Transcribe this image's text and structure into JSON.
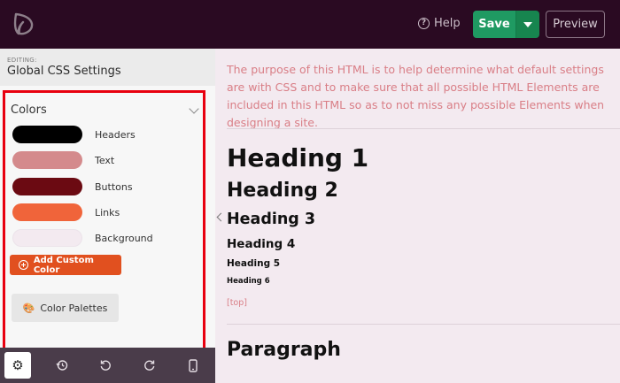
{
  "topbar": {
    "logo_icon": "leaf-logo-icon",
    "help_label": "Help",
    "save_label": "Save",
    "preview_label": "Preview"
  },
  "sidebar": {
    "editing_label": "EDITING:",
    "editing_title": "Global CSS Settings",
    "colors_title": "Colors",
    "colors": [
      {
        "label": "Headers",
        "color": "#000000"
      },
      {
        "label": "Text",
        "color": "#d48a8c"
      },
      {
        "label": "Buttons",
        "color": "#6b0a12"
      },
      {
        "label": "Links",
        "color": "#f0643a"
      },
      {
        "label": "Background",
        "color": "#f3eaf0"
      }
    ],
    "add_custom_color_label": "Add Custom Color",
    "color_palettes_label": "Color Palettes"
  },
  "toolbar": {
    "items": [
      "gear-icon",
      "history-icon",
      "undo-icon",
      "redo-icon",
      "mobile-icon"
    ]
  },
  "main": {
    "intro": "The purpose of this HTML is to help determine what default settings are with CSS and to make sure that all possible HTML Elements are included in this HTML so as to not miss any possible Elements when designing a site.",
    "h1": "Heading 1",
    "h2": "Heading 2",
    "h3": "Heading 3",
    "h4": "Heading 4",
    "h5": "Heading 5",
    "h6": "Heading 6",
    "top_link": "[top]",
    "paragraph_heading": "Paragraph"
  },
  "colors": {
    "topbar_bg": "#2a0a22",
    "save_green": "#1f9a62",
    "accent_orange": "#e1501f",
    "highlight_red": "#e8000f",
    "text_pink": "#d97e86"
  }
}
